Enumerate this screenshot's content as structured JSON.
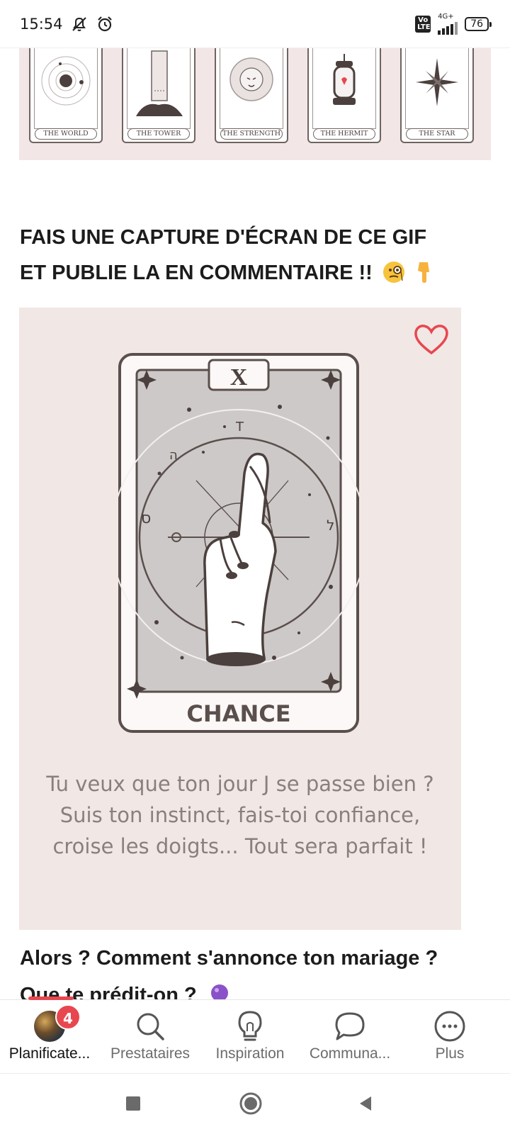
{
  "status": {
    "time": "15:54",
    "network": "4G+",
    "volte": "Vo LTE",
    "battery": "76"
  },
  "tarot_strip": {
    "cards": [
      "THE WORLD",
      "THE TOWER",
      "THE STRENGTH",
      "THE HERMIT",
      "THE STAR"
    ]
  },
  "post": {
    "heading_line1": "FAIS UNE CAPTURE D'ÉCRAN DE CE GIF",
    "heading_line2": "ET PUBLIE LA EN COMMENTAIRE !!",
    "gif": {
      "card_number": "X",
      "card_name": "CHANCE",
      "caption": "Tu veux que ton jour J se passe bien ? Suis ton instinct, fais-toi confiance, croise les doigts... Tout sera parfait !"
    },
    "question_line1": "Alors ? Comment s'annonce ton mariage ?",
    "question_line2": "Que te prédit-on ?"
  },
  "bottom_nav": {
    "items": [
      {
        "label": "Planificate...",
        "icon": "avatar",
        "badge": "4"
      },
      {
        "label": "Prestataires",
        "icon": "search-icon"
      },
      {
        "label": "Inspiration",
        "icon": "lightbulb-icon"
      },
      {
        "label": "Communa...",
        "icon": "chat-bubble-icon"
      },
      {
        "label": "Plus",
        "icon": "more-icon"
      }
    ]
  },
  "colors": {
    "accent": "#e8474f",
    "card_bg": "#f1e7e5",
    "ink": "#5a4f4c"
  }
}
